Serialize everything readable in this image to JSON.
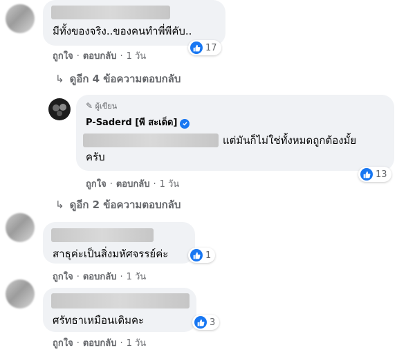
{
  "colors": {
    "accent": "#1877f2",
    "bubble": "#f0f2f5",
    "muted": "#65676b"
  },
  "comments": [
    {
      "text": "มีทั้งของจริง..ของคนทำพี่พีคับ..",
      "like": "ถูกใจ",
      "reply": "ตอบกลับ",
      "time": "1 วัน",
      "reactions": "17"
    },
    {
      "author_badge": "ผู้เขียน",
      "author": "P-Saderd [พี สะเด็ด]",
      "text_line1": "แต่มันก็ไม่ใช่ทั้งหมดถูกต้องมั้ย",
      "text_line2": "ครับ",
      "like": "ถูกใจ",
      "reply": "ตอบกลับ",
      "time": "1 วัน",
      "reactions": "13"
    },
    {
      "text": "สาธุค่ะเป็นสิ่งมหัศจรรย์ค่ะ",
      "like": "ถูกใจ",
      "reply": "ตอบกลับ",
      "time": "1 วัน",
      "reactions": "1"
    },
    {
      "text": "ศรัทธาเหมือนเดิมคะ",
      "like": "ถูกใจ",
      "reply": "ตอบกลับ",
      "time": "1 วัน",
      "reactions": "3"
    }
  ],
  "more_replies": [
    {
      "label": "ดูอีก 4 ข้อความตอบกลับ"
    },
    {
      "label": "ดูอีก 2 ข้อความตอบกลับ"
    }
  ],
  "icons": {
    "like": "thumbs-up-icon",
    "verified": "verified-check-icon",
    "author": "pencil-icon",
    "reply_arrow": "reply-arrow-icon"
  }
}
